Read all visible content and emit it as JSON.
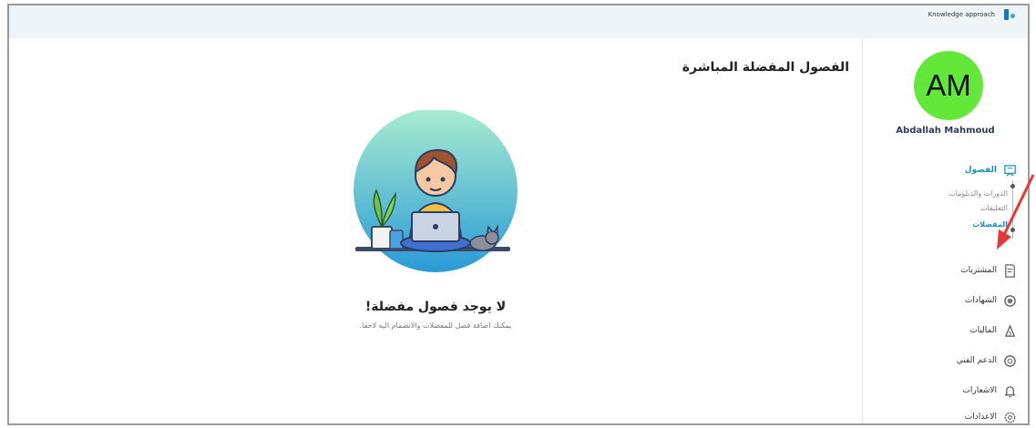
{
  "brand": {
    "text": "Knowledge approach"
  },
  "user": {
    "initials": "AM",
    "name": "Abdallah Mahmoud",
    "avatar_color": "#63e83a"
  },
  "nav": {
    "classes": "الفصول",
    "sub": {
      "courses": "الدورات والدبلومات",
      "comments": "التعليقات",
      "favorites": "المفضلات"
    },
    "purchases": "المشتريات",
    "certificates": "الشهادات",
    "financials": "الماليات",
    "support": "الدعم الفني",
    "notifications": "الاشعارات",
    "settings": "الاعدادات"
  },
  "main": {
    "title": "الفصول المفضلة المباشرة",
    "empty_title": "لا يوجد فصول مفضلة!",
    "empty_subtitle": "يمكنك اضافة فصل للمفضلات والانضمام اليه لاحقا."
  },
  "colors": {
    "accent": "#1a8fb8",
    "arrow": "#e53935",
    "topbar": "#eef4f8"
  },
  "icons": {
    "brand": "logo-icon",
    "classes": "classroom-icon",
    "purchases": "receipt-icon",
    "certificates": "certificate-icon",
    "financials": "money-bag-icon",
    "support": "support-icon",
    "notifications": "bell-icon",
    "settings": "settings-icon"
  }
}
